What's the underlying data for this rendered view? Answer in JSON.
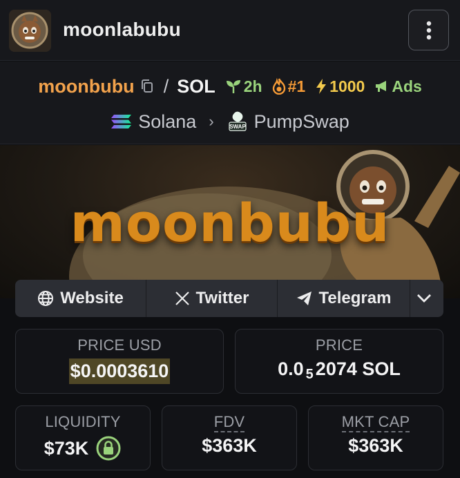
{
  "profile": {
    "name": "moonlabubu"
  },
  "pair": {
    "token": "moonbubu",
    "separator": "/",
    "quote": "SOL",
    "age": "2h",
    "rank": "#1",
    "boost": "1000",
    "ads": "Ads",
    "chain": "Solana",
    "dex": "PumpSwap",
    "dex_badge": "SWAP"
  },
  "banner": {
    "title": "moonbubu"
  },
  "links": {
    "website": "Website",
    "twitter": "Twitter",
    "telegram": "Telegram"
  },
  "stats": {
    "price_usd": {
      "label": "PRICE USD",
      "value": "$0.0003610"
    },
    "price": {
      "label": "PRICE",
      "value_prefix": "0.0",
      "value_sub": "5",
      "value_suffix": "2074 SOL"
    },
    "liquidity": {
      "label": "LIQUIDITY",
      "value": "$73K"
    },
    "fdv": {
      "label": "FDV",
      "value": "$363K"
    },
    "mkt_cap": {
      "label": "MKT CAP",
      "value": "$363K"
    }
  },
  "colors": {
    "token": "#f2a24c",
    "age": "#9ad37c",
    "rank": "#f59a36",
    "boost": "#f2c94c",
    "lock": "#9ad37c",
    "highlight": "#4f4726"
  },
  "icons": [
    "avatar-image",
    "more-vertical-icon",
    "copy-icon",
    "seedling-icon",
    "flame-icon",
    "bolt-icon",
    "megaphone-icon",
    "solana-icon",
    "pumpswap-icon",
    "chevron-right-icon",
    "globe-icon",
    "x-icon",
    "telegram-icon",
    "chevron-down-icon",
    "lock-icon"
  ]
}
